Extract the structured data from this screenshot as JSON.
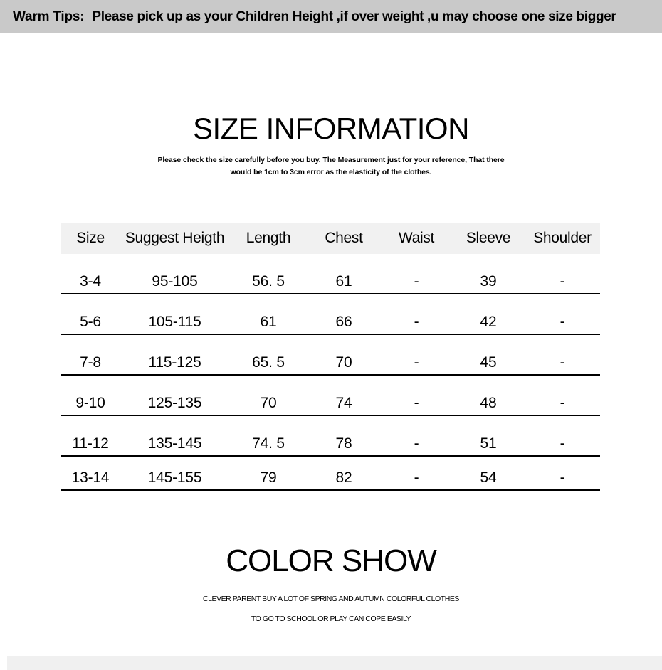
{
  "warm_tips": {
    "label": "Warm Tips:",
    "text": "Please pick up as your Children Height ,if over weight ,u may choose one size bigger",
    "background_color": "#c9c9c9"
  },
  "size_information": {
    "title": "SIZE INFORMATION",
    "subtitle": "Please check the size carefully before you buy. The Measurement just for your reference, That there would be 1cm to 3cm error as the elasticity of the clothes.",
    "table": {
      "header_background_color": "#f1f1f1",
      "columns": [
        "Size",
        "Suggest Heigth",
        "Length",
        "Chest",
        "Waist",
        "Sleeve",
        "Shoulder"
      ],
      "rows": [
        {
          "size": "3-4",
          "height": "95-105",
          "length": "56. 5",
          "chest": "61",
          "waist": "-",
          "sleeve": "39",
          "shoulder": "-"
        },
        {
          "size": "5-6",
          "height": "105-115",
          "length": "61",
          "chest": "66",
          "waist": "-",
          "sleeve": "42",
          "shoulder": "-"
        },
        {
          "size": "7-8",
          "height": "115-125",
          "length": "65. 5",
          "chest": "70",
          "waist": "-",
          "sleeve": "45",
          "shoulder": "-"
        },
        {
          "size": "9-10",
          "height": "125-135",
          "length": "70",
          "chest": "74",
          "waist": "-",
          "sleeve": "48",
          "shoulder": "-"
        },
        {
          "size": "11-12",
          "height": "135-145",
          "length": "74. 5",
          "chest": "78",
          "waist": "-",
          "sleeve": "51",
          "shoulder": "-"
        },
        {
          "size": "13-14",
          "height": "145-155",
          "length": "79",
          "chest": "82",
          "waist": "-",
          "sleeve": "54",
          "shoulder": "-"
        }
      ]
    }
  },
  "color_show": {
    "title": "COLOR SHOW",
    "subtitle_line1": "CLEVER PARENT BUY A LOT OF SPRING AND AUTUMN COLORFUL CLOTHES",
    "subtitle_line2": "TO GO TO SCHOOL OR PLAY CAN COPE EASILY"
  },
  "bottom_strip": {
    "background_color": "#f0f0f0"
  }
}
